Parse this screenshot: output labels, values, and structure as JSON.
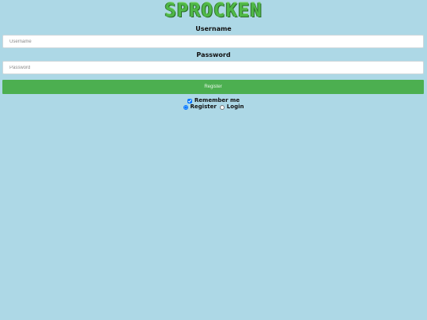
{
  "app": {
    "logo_text": "SPROCKEN",
    "brand_color": "#4caf50",
    "background_color": "#add8e6"
  },
  "form": {
    "username": {
      "label": "Username",
      "placeholder": "Username",
      "value": ""
    },
    "password": {
      "label": "Password",
      "placeholder": "Password",
      "value": ""
    },
    "submit_label": "Register",
    "remember_me": {
      "label": "Remember me",
      "checked": true
    },
    "mode": {
      "options": [
        {
          "label": "Register",
          "selected": true
        },
        {
          "label": "Login",
          "selected": false
        }
      ]
    }
  }
}
